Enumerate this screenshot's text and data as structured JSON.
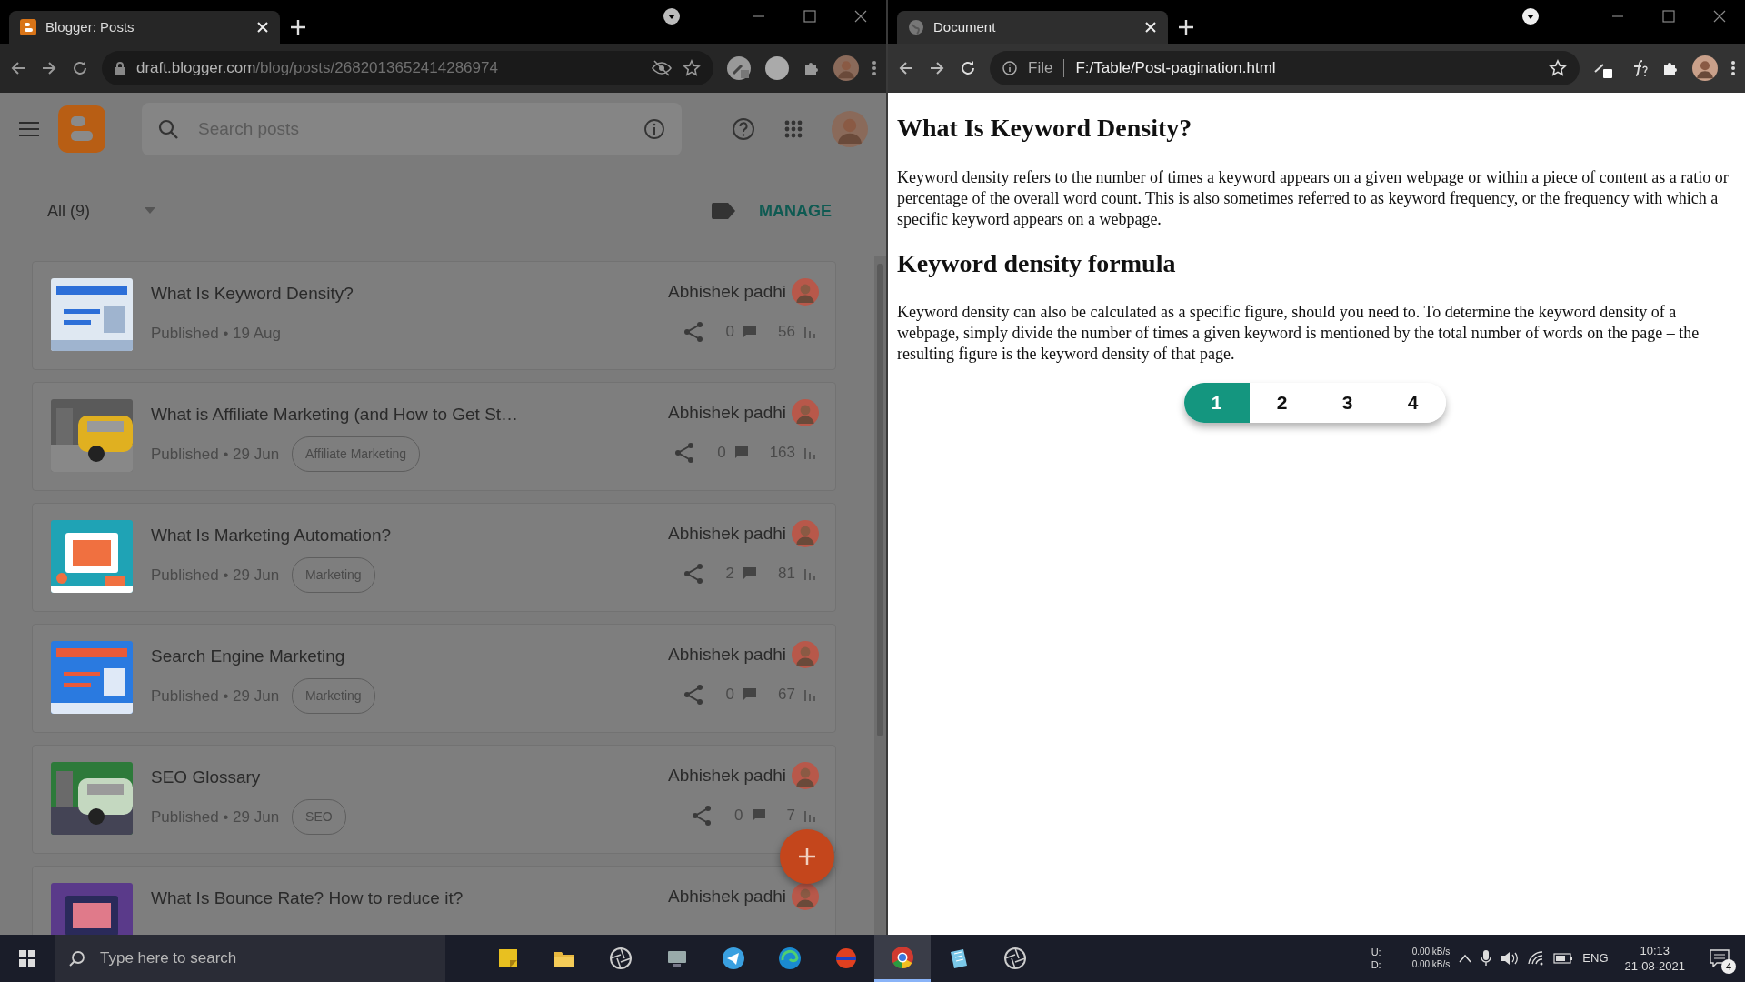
{
  "left_window": {
    "tab": {
      "title": "Blogger: Posts"
    },
    "address": {
      "host": "draft.blogger.com",
      "path": "/blog/posts/2682013652414286974"
    },
    "app": {
      "search": {
        "placeholder": "Search posts"
      },
      "filter": {
        "label": "All (9)"
      },
      "manage": "MANAGE",
      "posts": [
        {
          "title": "What Is Keyword Density?",
          "status": "Published • 19 Aug",
          "author": "Abhishek padhi",
          "comments": "0",
          "views": "56"
        },
        {
          "title": "What is Affiliate Marketing (and How to Get St…",
          "status": "Published • 29 Jun",
          "label": "Affiliate Marketing",
          "author": "Abhishek padhi",
          "comments": "0",
          "views": "163"
        },
        {
          "title": "What Is Marketing Automation?",
          "status": "Published • 29 Jun",
          "label": "Marketing",
          "author": "Abhishek padhi",
          "comments": "2",
          "views": "81"
        },
        {
          "title": "Search Engine Marketing",
          "status": "Published • 29 Jun",
          "label": "Marketing",
          "author": "Abhishek padhi",
          "comments": "0",
          "views": "67"
        },
        {
          "title": "SEO Glossary",
          "status": "Published • 29 Jun",
          "label": "SEO",
          "author": "Abhishek padhi",
          "comments": "0",
          "views": "7"
        },
        {
          "title": "What Is Bounce Rate? How to reduce it?",
          "author": "Abhishek padhi"
        }
      ]
    }
  },
  "right_window": {
    "tab": {
      "title": "Document"
    },
    "address": {
      "scheme": "File",
      "path": "F:/Table/Post-pagination.html"
    },
    "page": {
      "sections": [
        {
          "heading": "What Is Keyword Density?",
          "text": "Keyword density refers to the number of times a keyword appears on a given webpage or within a piece of content as a ratio or percentage of the overall word count. This is also sometimes referred to as keyword frequency, or the frequency with which a specific keyword appears on a webpage."
        },
        {
          "heading": "Keyword density formula",
          "text": "Keyword density can also be calculated as a specific figure, should you need to. To determine the keyword density of a webpage, simply divide the number of times a given keyword is mentioned by the total number of words on the page – the resulting figure is the keyword density of that page."
        }
      ],
      "pagination": [
        {
          "label": "1",
          "selected": true
        },
        {
          "label": "2",
          "selected": false
        },
        {
          "label": "3",
          "selected": false
        },
        {
          "label": "4",
          "selected": false
        }
      ]
    }
  },
  "taskbar": {
    "search": {
      "placeholder": "Type here to search"
    },
    "apps": [
      {
        "kind": "notes",
        "selected": false
      },
      {
        "kind": "folder",
        "selected": false
      },
      {
        "kind": "aperture",
        "selected": false
      },
      {
        "kind": "monitor",
        "selected": false
      },
      {
        "kind": "plane",
        "selected": false
      },
      {
        "kind": "swirl",
        "selected": false
      },
      {
        "kind": "ball",
        "selected": false
      },
      {
        "kind": "browser",
        "selected": true
      },
      {
        "kind": "notebook",
        "selected": false
      },
      {
        "kind": "aperture",
        "selected": false
      }
    ],
    "network": {
      "up_label": "U:",
      "down_label": "D:",
      "up": "0.00 kB/s",
      "down": "0.00 kB/s"
    },
    "language": "ENG",
    "time": "10:13",
    "date": "21-08-2021",
    "notifications": "4"
  }
}
